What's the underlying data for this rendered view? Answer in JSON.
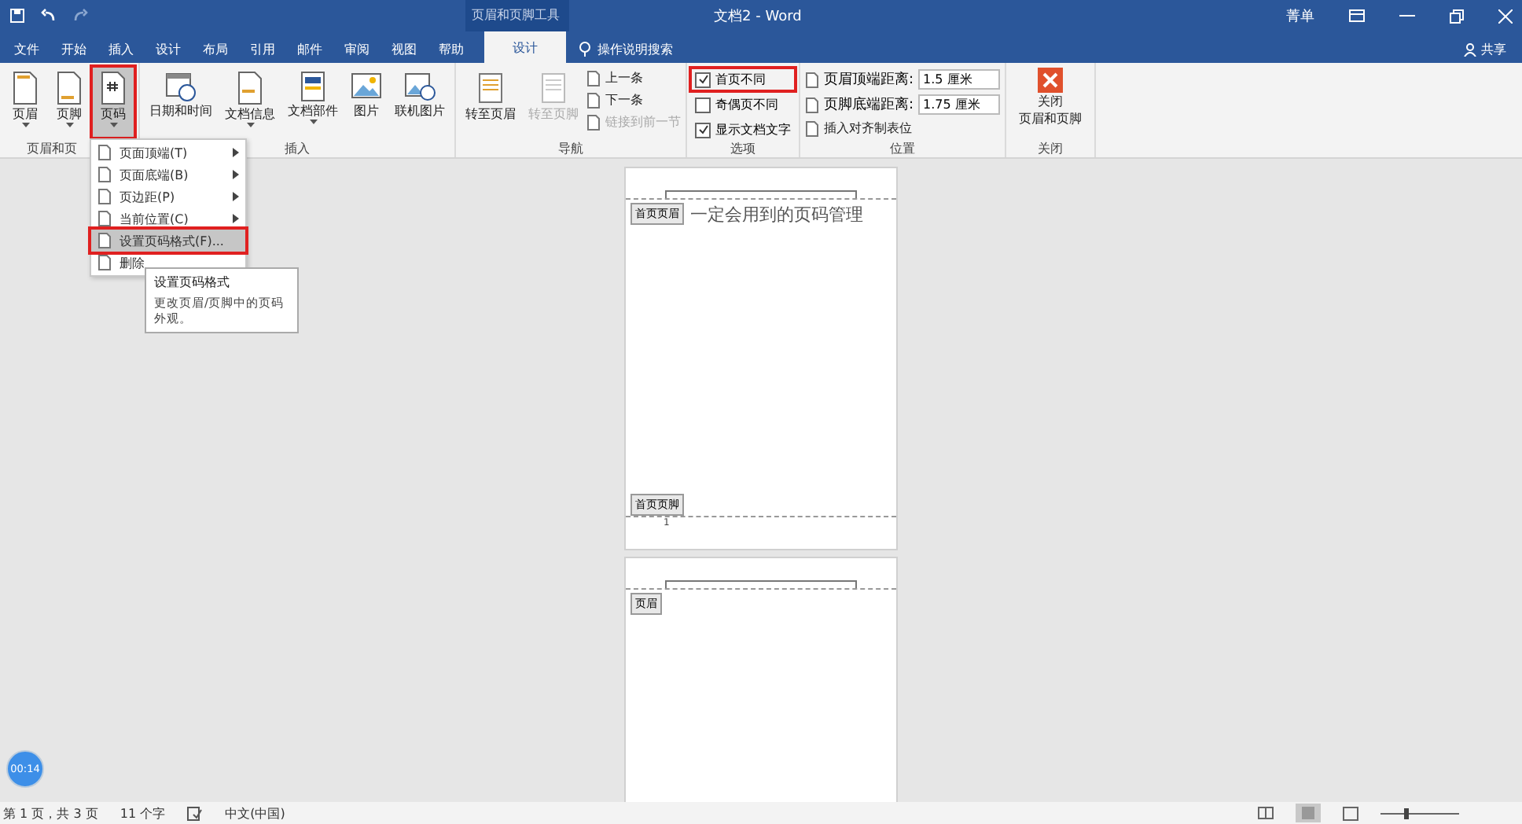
{
  "window": {
    "title": "文档2 - Word",
    "context_tab_title": "页眉和页脚工具",
    "account": "菁单"
  },
  "tabs": [
    {
      "label": "文件",
      "selected": false
    },
    {
      "label": "开始",
      "selected": false
    },
    {
      "label": "插入",
      "selected": false
    },
    {
      "label": "设计",
      "selected": false
    },
    {
      "label": "布局",
      "selected": false
    },
    {
      "label": "引用",
      "selected": false
    },
    {
      "label": "邮件",
      "selected": false
    },
    {
      "label": "审阅",
      "selected": false
    },
    {
      "label": "视图",
      "selected": false
    },
    {
      "label": "帮助",
      "selected": false
    },
    {
      "label": "设计",
      "selected": true
    }
  ],
  "search": {
    "label": "操作说明搜索"
  },
  "share": "共享",
  "ribbon": {
    "hf_group": {
      "label": "页眉和页",
      "buttons": [
        {
          "label": "页眉",
          "selected": false
        },
        {
          "label": "页脚",
          "selected": false
        },
        {
          "label": "页码",
          "selected": true
        }
      ]
    },
    "insert_group": {
      "label": "插入",
      "buttons": [
        {
          "label": "日期和时间",
          "dropdown": false
        },
        {
          "label": "文档信息",
          "dropdown": true
        },
        {
          "label": "文档部件",
          "dropdown": true
        },
        {
          "label": "图片",
          "dropdown": false
        },
        {
          "label": "联机图片",
          "dropdown": false
        }
      ]
    },
    "nav_group": {
      "label": "导航",
      "buttons": [
        {
          "label": "转至页眉",
          "disabled": false
        },
        {
          "label": "转至页脚",
          "disabled": true
        }
      ],
      "small": [
        {
          "label": "上一条",
          "disabled": false
        },
        {
          "label": "下一条",
          "disabled": false
        },
        {
          "label": "链接到前一节",
          "disabled": true
        }
      ]
    },
    "options_group": {
      "label": "选项",
      "checkboxes": [
        {
          "label": "首页不同",
          "checked": true,
          "highlighted": true
        },
        {
          "label": "奇偶页不同",
          "checked": false,
          "highlighted": false
        },
        {
          "label": "显示文档文字",
          "checked": true,
          "highlighted": false
        }
      ]
    },
    "position_group": {
      "label": "位置",
      "fields": [
        {
          "label": "页眉顶端距离:",
          "value": "1.5 厘米"
        },
        {
          "label": "页脚底端距离:",
          "value": "1.75 厘米"
        }
      ],
      "insert_tab": "插入对齐制表位"
    },
    "close_group": {
      "label": "关闭",
      "button": [
        "关闭",
        "页眉和页脚"
      ]
    }
  },
  "menu": {
    "items": [
      {
        "label": "页面顶端(T)",
        "submenu": true,
        "highlighted": false
      },
      {
        "label": "页面底端(B)",
        "submenu": true,
        "highlighted": false
      },
      {
        "label": "页边距(P)",
        "submenu": true,
        "highlighted": false
      },
      {
        "label": "当前位置(C)",
        "submenu": true,
        "highlighted": false
      },
      {
        "label": "设置页码格式(F)...",
        "submenu": false,
        "highlighted": true
      },
      {
        "label": "删除",
        "submenu": false,
        "highlighted": false
      }
    ]
  },
  "tooltip": {
    "title": "设置页码格式",
    "text": "更改页眉/页脚中的页码外观。"
  },
  "pages": [
    {
      "header_tag": "首页页眉",
      "body": "一定会用到的页码管理",
      "footer_tag": "首页页脚",
      "page_number": "1"
    },
    {
      "header_tag": "页眉"
    }
  ],
  "timer": "00:14",
  "status_bar": {
    "page": "第 1 页，共 3 页",
    "words": "11 个字",
    "language": "中文(中国)",
    "zoom": {
      "level": 0.3
    }
  }
}
